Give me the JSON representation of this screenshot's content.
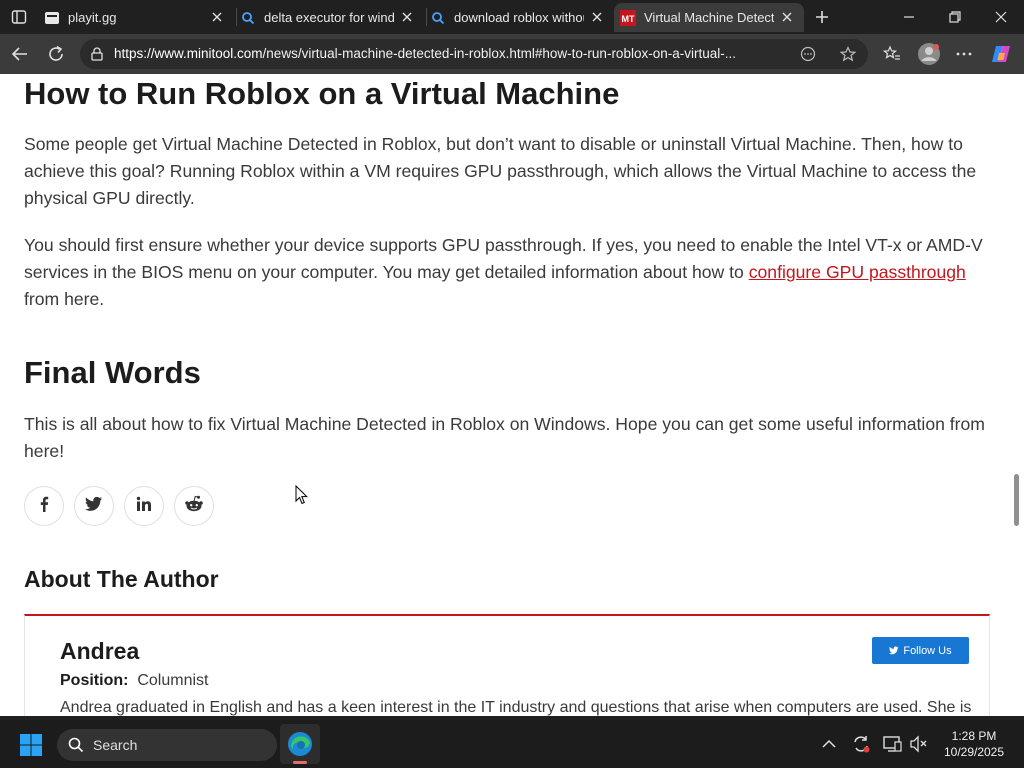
{
  "browser": {
    "tabs": [
      {
        "title": "playit.gg",
        "active": false
      },
      {
        "title": "delta executor for windo",
        "active": false
      },
      {
        "title": "download roblox withou",
        "active": false
      },
      {
        "title": "Virtual Machine Detecte",
        "active": true
      }
    ],
    "url_host": "https://www.minitool.com",
    "url_path": "/news/virtual-machine-detected-in-roblox.html#how-to-run-roblox-on-a-virtual-..."
  },
  "article": {
    "heading1": "How to Run Roblox on a Virtual Machine",
    "para1": "Some people get Virtual Machine Detected in Roblox, but don’t want to disable or uninstall Virtual Machine. Then, how to achieve this goal? Running Roblox within a VM requires GPU passthrough, which allows the Virtual Machine to access the physical GPU directly.",
    "para2_before": "You should first ensure whether your device supports GPU passthrough. If yes, you need to enable the Intel VT-x or AMD-V services in the BIOS menu on your computer. You may get detailed information about how to ",
    "para2_link": "configure GPU passthrough",
    "para2_after": " from here.",
    "heading2": "Final Words",
    "para3": "This is all about how to fix Virtual Machine Detected in Roblox on Windows. Hope you can get some useful information from here!",
    "social_icons": [
      "facebook-icon",
      "twitter-icon",
      "linkedin-icon",
      "reddit-icon"
    ],
    "about_heading": "About The Author",
    "author": {
      "name": "Andrea",
      "position_label": "Position:",
      "position_value": "Columnist",
      "follow_label": "Follow Us",
      "bio": "Andrea graduated in English and has a keen interest in the IT industry and questions that arise when computers are used. She is"
    }
  },
  "taskbar": {
    "search_label": "Search",
    "time": "1:28 PM",
    "date": "10/29/2025"
  },
  "colors": {
    "link": "#c4161c",
    "follow_button": "#1877d2",
    "accent_line": "#c4161c"
  }
}
